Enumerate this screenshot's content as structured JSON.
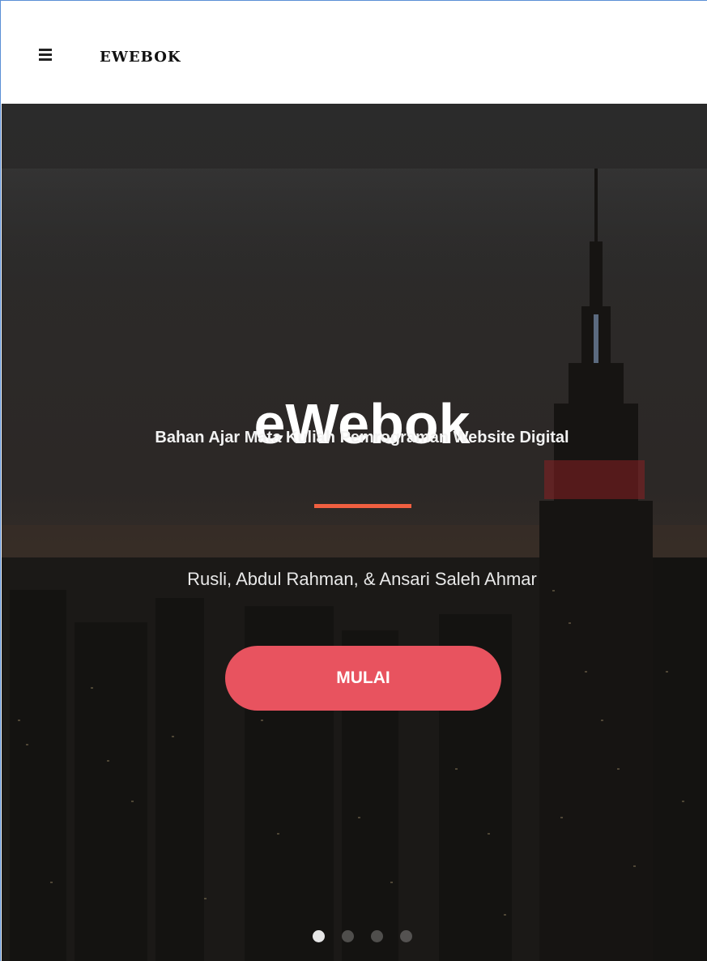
{
  "navbar": {
    "brand": "EWEBOK"
  },
  "hero": {
    "title": "eWebok",
    "subtitle": "Bahan Ajar Mata Kuliah Pemrograman Website Digital",
    "authors": "Rusli, Abdul Rahman, & Ansari Saleh Ahmar",
    "cta_label": "MULAI",
    "slides": [
      {
        "active": true
      },
      {
        "active": false
      },
      {
        "active": false
      },
      {
        "active": false
      }
    ]
  },
  "colors": {
    "accent_divider": "#f05f40",
    "cta_background": "#e8535f",
    "hero_overlay": "#1e1b19"
  }
}
